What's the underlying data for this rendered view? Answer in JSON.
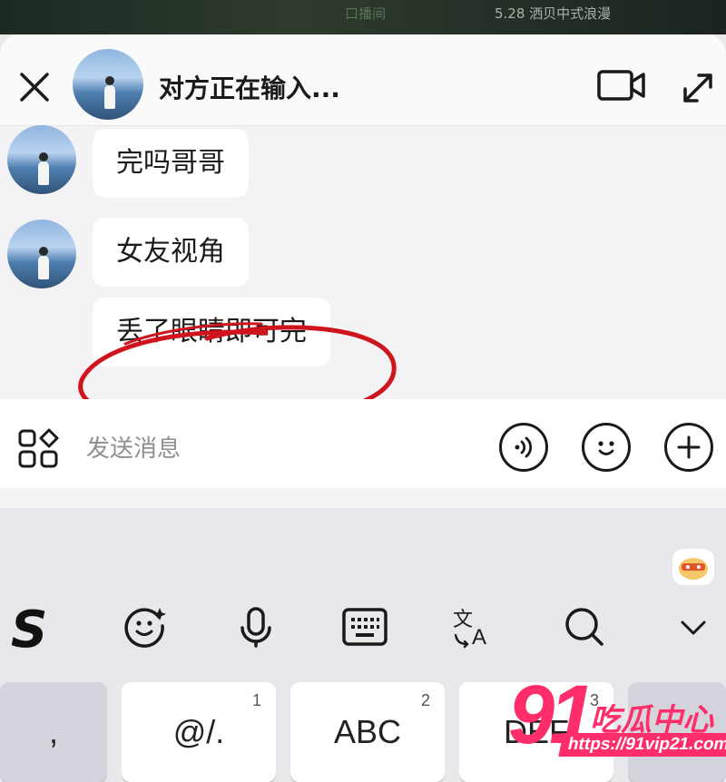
{
  "background_video": {
    "overlay_text_left": "口播间",
    "overlay_text_right": "5.28 洒贝中式浪漫"
  },
  "chat": {
    "title": "对方正在输入...",
    "messages": [
      {
        "from": "other",
        "text": "完吗哥哥"
      },
      {
        "from": "other",
        "text": "女友视角"
      },
      {
        "from": "other",
        "text": "丢了眼睛即可完"
      }
    ],
    "annotation_color": "#d0141e"
  },
  "input": {
    "placeholder": "发送消息"
  },
  "keyboard": {
    "keys": [
      {
        "label": ",",
        "number": ""
      },
      {
        "label": "@/.",
        "number": "1"
      },
      {
        "label": "ABC",
        "number": "2"
      },
      {
        "label": "DEF",
        "number": "3"
      }
    ]
  },
  "watermark": {
    "number": "91",
    "text": "吃瓜中心",
    "url": "https://91vip21.com",
    "color": "#ff2e6a"
  },
  "icons": [
    "close-icon",
    "video-call-icon",
    "expand-icon",
    "apps-icon",
    "voice-icon",
    "emoji-icon",
    "plus-icon",
    "sogou-logo-icon",
    "sticker-icon",
    "microphone-icon",
    "keyboard-icon",
    "translate-icon",
    "search-icon",
    "chevron-down-icon"
  ]
}
